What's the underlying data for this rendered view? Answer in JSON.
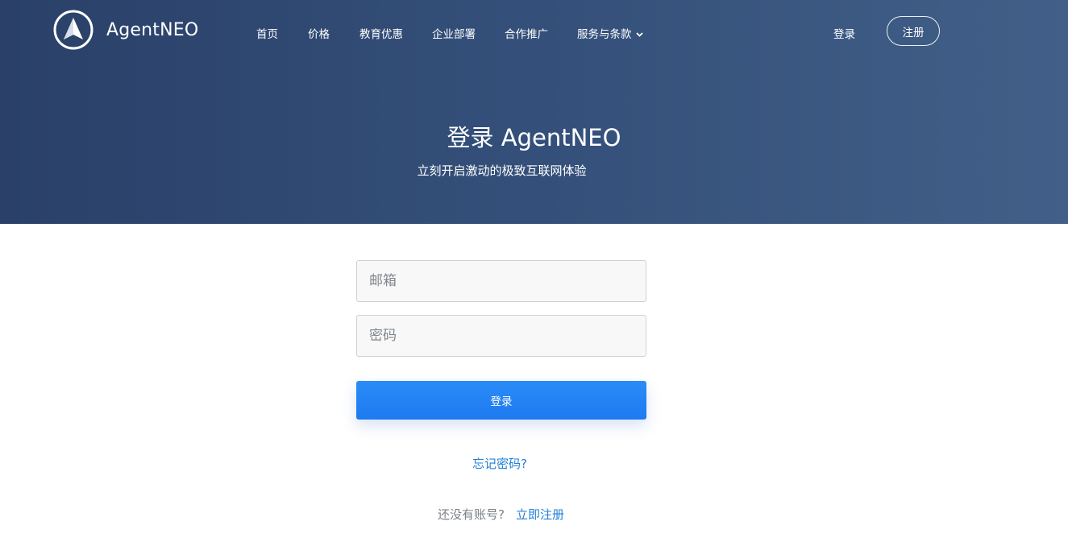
{
  "brand": {
    "name": "AgentNEO",
    "logo_icon": "compass-arrow-icon"
  },
  "nav": {
    "items": [
      {
        "label": "首页"
      },
      {
        "label": "价格"
      },
      {
        "label": "教育优惠"
      },
      {
        "label": "企业部署"
      },
      {
        "label": "合作推广"
      },
      {
        "label": "服务与条款",
        "icon": "chevron-down-icon"
      }
    ],
    "login_label": "登录",
    "signup_label": "注册"
  },
  "hero": {
    "title": "登录 AgentNEO",
    "subtitle": "立刻开启激动的极致互联网体验"
  },
  "form": {
    "email_placeholder": "邮箱",
    "password_placeholder": "密码",
    "submit_label": "登录",
    "forgot_label": "忘记密码?",
    "no_account_text": "还没有账号?",
    "register_label": "立即注册"
  },
  "colors": {
    "hero_start": "#2a4068",
    "hero_end": "#415f88",
    "primary": "#1d7af0",
    "link": "#1f7fd6"
  }
}
